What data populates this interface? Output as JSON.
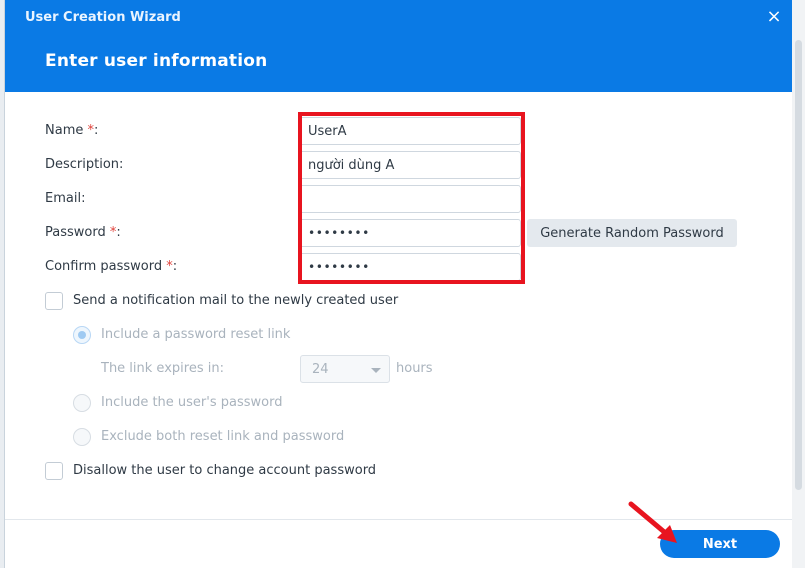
{
  "dialog": {
    "title": "User Creation Wizard",
    "close_icon": "×",
    "step_title": "Enter user information"
  },
  "form": {
    "name": {
      "label": "Name ",
      "required_mark": "*",
      "suffix": ":",
      "value": "UserA"
    },
    "description": {
      "label": "Description:",
      "value": "người dùng A"
    },
    "email": {
      "label": "Email:",
      "value": ""
    },
    "password": {
      "label": "Password ",
      "required_mark": "*",
      "suffix": ":",
      "value": "••••••••"
    },
    "confirm_password": {
      "label": "Confirm password ",
      "required_mark": "*",
      "suffix": ":",
      "value": "••••••••"
    },
    "generate_button": "Generate Random Password"
  },
  "options": {
    "notify": {
      "label": "Send a notification mail to the newly created user",
      "checked": false
    },
    "reset_link": {
      "label": "Include a password reset link",
      "selected": true,
      "disabled": true
    },
    "expires": {
      "label": "The link expires in:",
      "value": "24",
      "unit": "hours"
    },
    "include_password": {
      "label": "Include the user's password",
      "selected": false,
      "disabled": true
    },
    "exclude_both": {
      "label": "Exclude both reset link and password",
      "selected": false,
      "disabled": true
    },
    "disallow_change": {
      "label": "Disallow the user to change account password",
      "checked": false
    }
  },
  "footer": {
    "next_label": "Next"
  },
  "colors": {
    "accent": "#0a7ae5",
    "highlight": "#e8141f",
    "required": "#e0413a"
  }
}
